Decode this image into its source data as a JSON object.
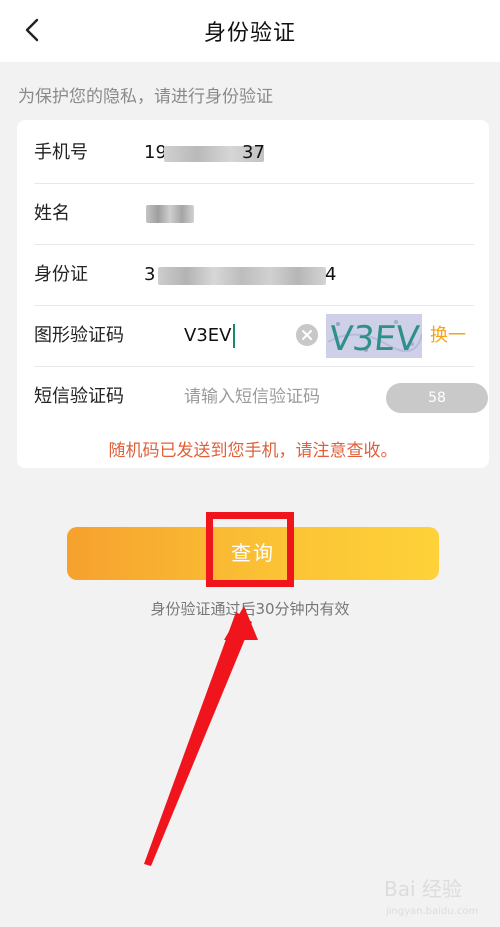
{
  "header": {
    "title": "身份验证",
    "back_icon": "chevron-left-icon"
  },
  "subtitle": "为保护您的隐私，请进行身份验证",
  "form": {
    "phone": {
      "label": "手机号",
      "value_start": "19",
      "value_end": "37"
    },
    "name": {
      "label": "姓名"
    },
    "id_card": {
      "label": "身份证",
      "value_start": "3",
      "value_end": "4"
    },
    "captcha": {
      "label": "图形验证码",
      "value": "V3EV",
      "image_text": "V3EV",
      "clear_icon": "clear-icon",
      "switch_label": "换一换"
    },
    "sms": {
      "label": "短信验证码",
      "placeholder": "请输入短信验证码",
      "countdown": "58"
    },
    "notice": "随机码已发送到您手机，请注意查收。"
  },
  "query_button": "查询",
  "hint": "身份验证通过后30分钟内有效",
  "watermark": {
    "logo": "Bai 经验",
    "sub": "jingyan.baidu.com"
  },
  "colors": {
    "accent_orange": "#f4a31d",
    "notice_red": "#e0603a",
    "annotation_red": "#f0141c",
    "button_gradient": [
      "#f6a12e",
      "#fed238"
    ]
  }
}
